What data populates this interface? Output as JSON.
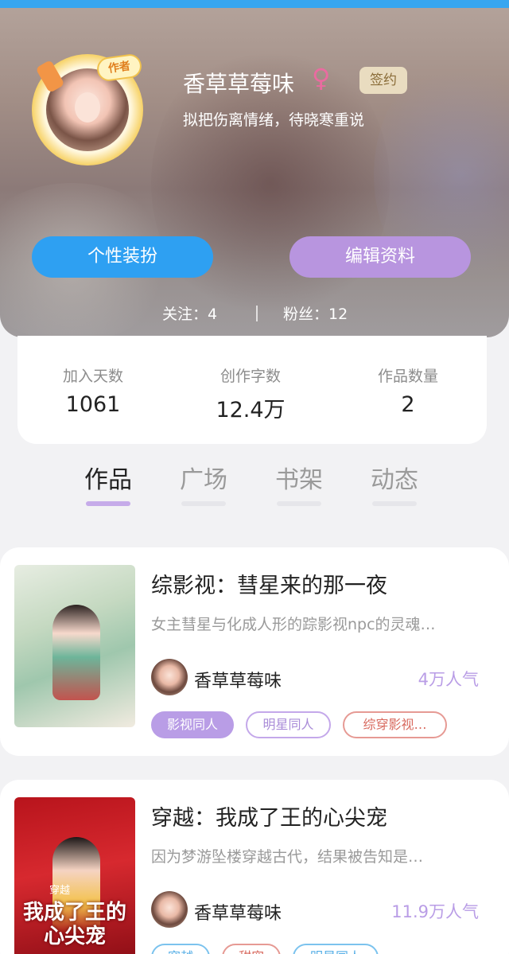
{
  "colors": {
    "accent_blue": "#2ea0f2",
    "accent_purple": "#b895df",
    "popularity": "#b99de6"
  },
  "profile": {
    "avatar_badge": "作者",
    "name": "香草草莓味",
    "gender_icon": "♀",
    "sign_badge": "签约",
    "bio": "拟把伤离情绪，待晓寒重说"
  },
  "actions": {
    "dress_up": "个性装扮",
    "edit_profile": "编辑资料"
  },
  "follow": {
    "following": "关注：4",
    "fans": "粉丝：12"
  },
  "stats": [
    {
      "label": "加入天数",
      "value": "1061"
    },
    {
      "label": "创作字数",
      "value": "12.4万"
    },
    {
      "label": "作品数量",
      "value": "2"
    }
  ],
  "tabs": [
    {
      "label": "作品",
      "active": true
    },
    {
      "label": "广场",
      "active": false
    },
    {
      "label": "书架",
      "active": false
    },
    {
      "label": "动态",
      "active": false
    }
  ],
  "works": [
    {
      "title": "综影视：彗星来的那一夜",
      "description": "女主彗星与化成人形的踪影视npc的灵魂…",
      "author": "香草草莓味",
      "popularity": "4万人气",
      "tags": [
        "影视同人",
        "明星同人",
        "综穿影视…"
      ]
    },
    {
      "title": "穿越：我成了王的心尖宠",
      "description": "因为梦游坠楼穿越古代，结果被告知是…",
      "author": "香草草莓味",
      "popularity": "11.9万人气",
      "cover_tag": "穿越",
      "cover_title": "我成了王的心尖宠",
      "tags": [
        "穿越",
        "甜宠",
        "明星同人"
      ]
    }
  ]
}
